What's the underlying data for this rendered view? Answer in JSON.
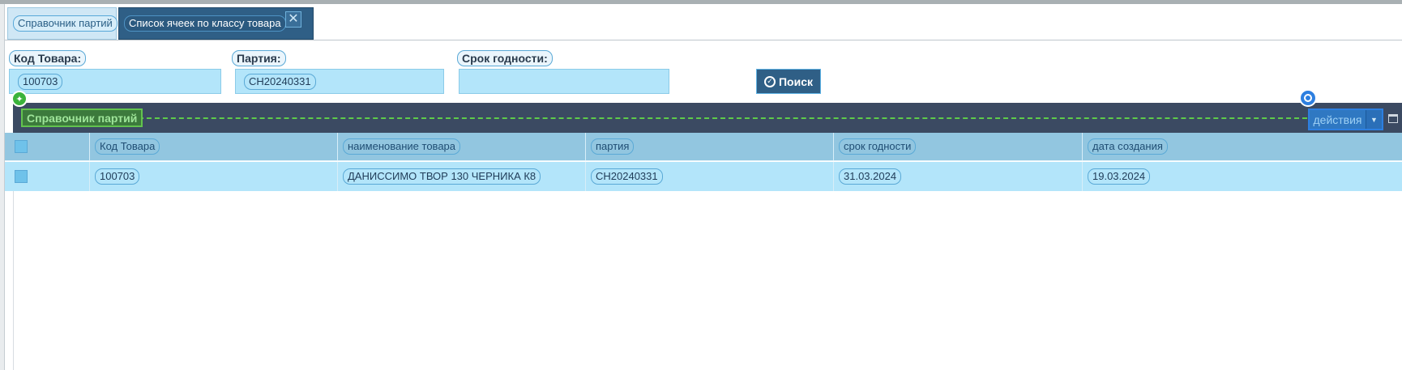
{
  "tabs": [
    {
      "label": "Справочник партий",
      "active": false
    },
    {
      "label": "Список ячеек по классу товара",
      "active": true
    }
  ],
  "tab_close_glyph": "✕",
  "filters": {
    "code": {
      "label": "Код Товара:",
      "value": "100703"
    },
    "batch": {
      "label": "Партия:",
      "value": "CH20240331"
    },
    "expiry": {
      "label": "Срок годности:",
      "value": ""
    },
    "search_button": "Поиск"
  },
  "grid": {
    "title": "Справочник партий",
    "actions_label": "действия",
    "columns": [
      "Код Товара",
      "наименование товара",
      "партия",
      "срок годности",
      "дата создания"
    ],
    "rows": [
      {
        "code": "100703",
        "name": "ДАНИССИМО ТВОР 130 ЧЕРНИКА К8",
        "batch": "CH20240331",
        "expiry": "31.03.2024",
        "created": "19.03.2024"
      }
    ]
  },
  "icons": {
    "pin": "pin-icon",
    "target": "target-icon",
    "search_check": "check-circle-icon",
    "dropdown": "chevron-down-icon",
    "window": "window-icon"
  },
  "colors": {
    "active_tab": "#2f5f86",
    "grid_bar": "#3b4a62",
    "row_background": "#b3e5fa",
    "header_background": "#92c6e0",
    "highlight_green": "#5ecb4a",
    "highlight_blue": "#2d7fe0"
  }
}
